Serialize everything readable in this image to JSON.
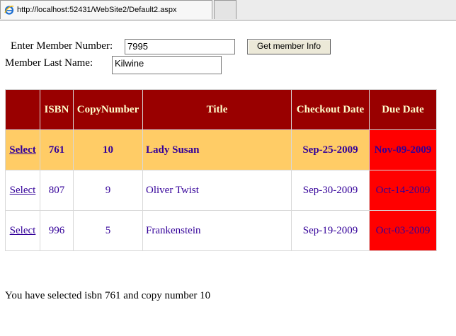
{
  "browser": {
    "tab_url": "http://localhost:52431/WebSite2/Default2.aspx",
    "tab_icon": "ie-icon"
  },
  "form": {
    "member_number_label": "Enter Member Number:",
    "member_number_value": "7995",
    "get_button_label": "Get member Info",
    "last_name_label": "Member Last Name:",
    "last_name_value": "Kilwine"
  },
  "grid": {
    "headers": [
      "",
      "ISBN",
      "CopyNumber",
      "Title",
      "Checkout Date",
      "Due Date"
    ],
    "rows": [
      {
        "select": "Select",
        "isbn": "761",
        "copy": "10",
        "title": "Lady Susan",
        "checkout": "Sep-25-2009",
        "due": "Nov-09-2009"
      },
      {
        "select": "Select",
        "isbn": "807",
        "copy": "9",
        "title": "Oliver Twist",
        "checkout": "Sep-30-2009",
        "due": "Oct-14-2009"
      },
      {
        "select": "Select",
        "isbn": "996",
        "copy": "5",
        "title": "Frankenstein",
        "checkout": "Sep-19-2009",
        "due": "Oct-03-2009"
      }
    ],
    "colors": {
      "header_bg": "#990000",
      "header_text": "#ffffcc",
      "selected_row_bg": "#ffcc66",
      "overdue_bg": "#ff0000",
      "text": "#330099"
    }
  },
  "result_text": "You have selected isbn 761 and copy number 10"
}
